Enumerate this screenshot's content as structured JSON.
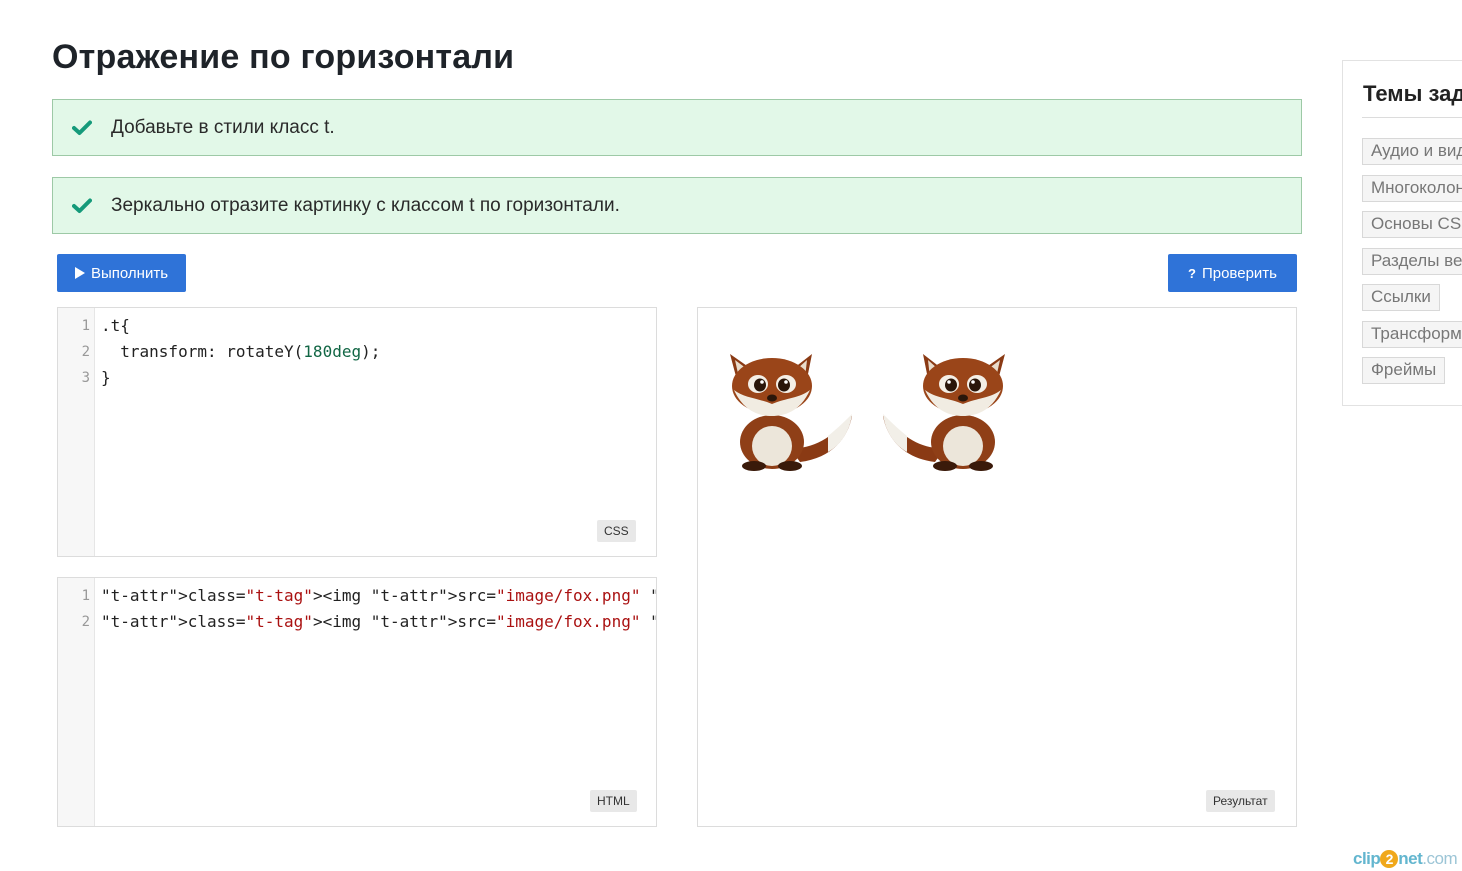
{
  "page": {
    "title": "Отражение по горизонтали"
  },
  "tasks": [
    {
      "text": "Добавьте в стили класс t.",
      "status": "done"
    },
    {
      "text": "Зеркально отразите картинку с классом t по горизонтали.",
      "status": "done"
    }
  ],
  "toolbar": {
    "run_label": "Выполнить",
    "check_label": "Проверить",
    "run_icon": "play-icon",
    "check_icon": "question-icon"
  },
  "css_editor": {
    "badge": "CSS",
    "line_numbers": [
      "1",
      "2",
      "3"
    ],
    "lines": [
      ".t{",
      "  transform: rotateY(180deg);",
      "}"
    ]
  },
  "html_editor": {
    "badge": "HTML",
    "line_numbers": [
      "1",
      "2"
    ],
    "lines": [
      "<img src=\"image/fox.png\" alt=\"Лиса\">",
      "<img src=\"image/fox.png\" alt=\"Лиса\" class=\"t\">"
    ]
  },
  "result": {
    "badge": "Результат",
    "images": [
      {
        "alt": "Лиса"
      },
      {
        "alt": "Лиса"
      }
    ]
  },
  "sidebar": {
    "title": "Темы задач",
    "tags": [
      "Аудио и видео",
      "Многоколонность",
      "Основы CSS",
      "Разделы веб-страниц",
      "Ссылки",
      "Трансформации",
      "Фреймы"
    ]
  },
  "watermark": {
    "part1": "clip",
    "part2": "2",
    "part3": "net",
    "part4": ".com"
  },
  "colors": {
    "accent": "#2f73d8",
    "success_bg": "#e2f8e8",
    "check": "#159a7a"
  }
}
